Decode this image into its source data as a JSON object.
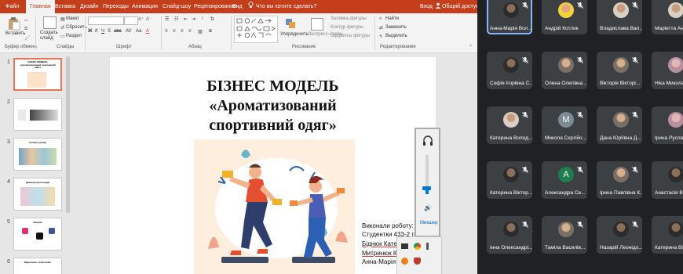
{
  "ribbon": {
    "tabs": [
      "Файл",
      "Главная",
      "Вставка",
      "Дизайн",
      "Переходы",
      "Анимация",
      "Слайд-шоу",
      "Рецензирование",
      "Вид"
    ],
    "active_tab": "Главная",
    "search_placeholder": "Что вы хотите сделать?",
    "right": {
      "signin": "Вход",
      "share": "Общий доступ"
    },
    "clipboard": {
      "paste": "Вставить",
      "group": "Буфер обмена"
    },
    "slides": {
      "create": "Создать слайд",
      "layout": "Макет",
      "reset": "Сбросить",
      "section": "Раздел",
      "group": "Слайды"
    },
    "font_group": "Шрифт",
    "paragraph_group": "Абзац",
    "drawing": {
      "arrange": "Упорядочить",
      "quick_styles": "Экспресс-стили",
      "fill": "Заливка фигуры",
      "outline": "Контур фигуры",
      "effects": "Эффекты фигуры",
      "group": "Рисование"
    },
    "editing": {
      "find": "Найти",
      "replace": "Заменить",
      "select": "Выделить",
      "group": "Редактирование"
    }
  },
  "thumbnails": {
    "numbers": [
      "1",
      "2",
      "3",
      "4",
      "5",
      "6"
    ],
    "thumb1_title": "БІЗНЕС МОДЕЛЬ «Ароматизований спортивний одяг»",
    "thumb3_title": "Сегмент ринку",
    "thumb4_title": "Ціннісна пропозиція",
    "thumb5_title": "Канали",
    "thumb6_title": "Відносини з клієнтами"
  },
  "slide": {
    "title_line1": "БІЗНЕС МОДЕЛЬ",
    "title_line2": "«Ароматизований",
    "title_line3": "спортивний одяг»",
    "author1": "Виконали роботу:",
    "author2": "Студентки 433-2 гр.",
    "author3": "Біднюк Катерина",
    "author4": "Митринюк Катерина",
    "author5": "Анна-Марія"
  },
  "volume": {
    "label": "Микшер",
    "level": 0.15
  },
  "participants": [
    {
      "name": "Анна-Марія Вол...",
      "avatar": "photo-dark",
      "active": true
    },
    {
      "name": "Андрій Котлик",
      "avatar": "photo-yellow",
      "active": false
    },
    {
      "name": "Владислава Вал...",
      "avatar": "photo-light",
      "active": false
    },
    {
      "name": "Маріетта Анат...",
      "avatar": "photo-light",
      "active": false
    },
    {
      "name": "Софія Ігорівна С...",
      "avatar": "photo-dark",
      "active": false
    },
    {
      "name": "Олена Олегівна ...",
      "avatar": "photo-mixed",
      "active": false
    },
    {
      "name": "Вікторія Вікторі...",
      "avatar": "photo-mixed",
      "active": false
    },
    {
      "name": "Ніка Миколаїв...",
      "avatar": "photo-pink",
      "active": false
    },
    {
      "name": "Катерина Волод...",
      "avatar": "photo-light",
      "active": false
    },
    {
      "name": "Микола Сергійо...",
      "avatar": "letter",
      "letter": "M",
      "color": "#7b8a93",
      "active": false
    },
    {
      "name": "Дана Юріївна Д...",
      "avatar": "photo-mixed",
      "active": false
    },
    {
      "name": "Ірина Русланів...",
      "avatar": "photo-pink",
      "active": false
    },
    {
      "name": "Катерина Віктор...",
      "avatar": "photo-dark",
      "active": false
    },
    {
      "name": "Александра Се...",
      "avatar": "letter",
      "letter": "A",
      "color": "#1e7d4f",
      "active": false
    },
    {
      "name": "Ірина Павлівна К...",
      "avatar": "photo-mixed",
      "active": false
    },
    {
      "name": "Анастасія Вікт...",
      "avatar": "photo-dark",
      "active": false
    },
    {
      "name": "Інна Олександрі...",
      "avatar": "photo-dark",
      "active": false
    },
    {
      "name": "Таміла Василів...",
      "avatar": "photo-mixed",
      "active": false
    },
    {
      "name": "Назарій Леонідо...",
      "avatar": "photo-dark",
      "active": false
    },
    {
      "name": "Катерина Вікто...",
      "avatar": "photo-dark",
      "active": false
    }
  ],
  "colors": {
    "ppt_red": "#c43e1c",
    "meet_bg": "#202124",
    "tile_bg": "#3c4043",
    "active_border": "#8ab4f8"
  }
}
